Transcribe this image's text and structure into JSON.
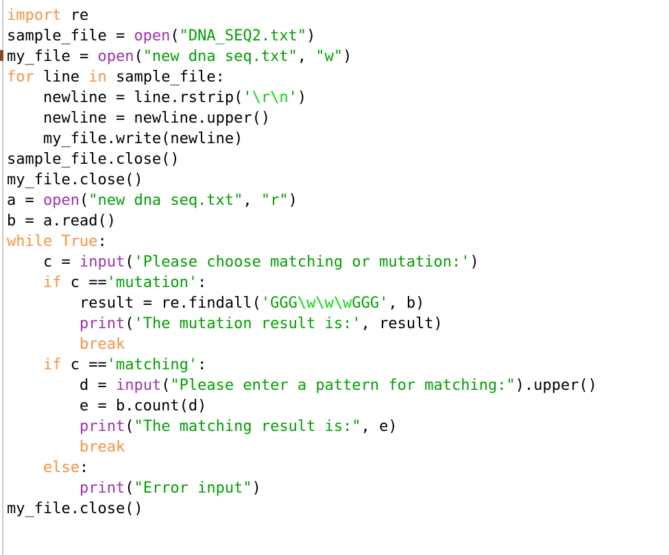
{
  "document": {
    "kind": "python-source-code",
    "language": "Python",
    "background_color": "#ffffff",
    "default_text_color": "#000000"
  },
  "theme": {
    "keyword_color": "#ff9040",
    "builtin_color": "#a030b0",
    "string_color": "#00a000",
    "escape_color": "#00e000",
    "identifier_color": "#000000",
    "gutter_rule_color": "#c9c9c9",
    "gutter_marker_color": "#8a4a20"
  },
  "code": {
    "lines": [
      [
        {
          "t": "import",
          "c": "kw"
        },
        {
          "t": " re",
          "c": "id"
        }
      ],
      [
        {
          "t": "sample_file = ",
          "c": "id"
        },
        {
          "t": "open",
          "c": "bi"
        },
        {
          "t": "(",
          "c": "id"
        },
        {
          "t": "\"DNA_SEQ2.txt\"",
          "c": "str"
        },
        {
          "t": ")",
          "c": "id"
        }
      ],
      [
        {
          "t": "my_file = ",
          "c": "id"
        },
        {
          "t": "open",
          "c": "bi"
        },
        {
          "t": "(",
          "c": "id"
        },
        {
          "t": "\"new dna seq.txt\"",
          "c": "str"
        },
        {
          "t": ", ",
          "c": "id"
        },
        {
          "t": "\"w\"",
          "c": "str"
        },
        {
          "t": ")",
          "c": "id"
        }
      ],
      [
        {
          "t": "for",
          "c": "kw"
        },
        {
          "t": " line ",
          "c": "id"
        },
        {
          "t": "in",
          "c": "kw"
        },
        {
          "t": " sample_file:",
          "c": "id"
        }
      ],
      [
        {
          "t": "    newline = line.rstrip(",
          "c": "id"
        },
        {
          "t": "'",
          "c": "str"
        },
        {
          "t": "\\r",
          "c": "esc"
        },
        {
          "t": "\\n",
          "c": "esc"
        },
        {
          "t": "'",
          "c": "str"
        },
        {
          "t": ")",
          "c": "id"
        }
      ],
      [
        {
          "t": "    newline = newline.upper()",
          "c": "id"
        }
      ],
      [
        {
          "t": "    my_file.write(newline)",
          "c": "id"
        }
      ],
      [
        {
          "t": "sample_file.close()",
          "c": "id"
        }
      ],
      [
        {
          "t": "my_file.close()",
          "c": "id"
        }
      ],
      [
        {
          "t": "a = ",
          "c": "id"
        },
        {
          "t": "open",
          "c": "bi"
        },
        {
          "t": "(",
          "c": "id"
        },
        {
          "t": "\"new dna seq.txt\"",
          "c": "str"
        },
        {
          "t": ", ",
          "c": "id"
        },
        {
          "t": "\"r\"",
          "c": "str"
        },
        {
          "t": ")",
          "c": "id"
        }
      ],
      [
        {
          "t": "b = a.read()",
          "c": "id"
        }
      ],
      [
        {
          "t": "while",
          "c": "kw"
        },
        {
          "t": " ",
          "c": "id"
        },
        {
          "t": "True",
          "c": "kw"
        },
        {
          "t": ":",
          "c": "id"
        }
      ],
      [
        {
          "t": "    c = ",
          "c": "id"
        },
        {
          "t": "input",
          "c": "bi"
        },
        {
          "t": "(",
          "c": "id"
        },
        {
          "t": "'Please choose matching or mutation:'",
          "c": "str"
        },
        {
          "t": ")",
          "c": "id"
        }
      ],
      [
        {
          "t": "    ",
          "c": "id"
        },
        {
          "t": "if",
          "c": "kw"
        },
        {
          "t": " c ==",
          "c": "id"
        },
        {
          "t": "'mutation'",
          "c": "str"
        },
        {
          "t": ":",
          "c": "id"
        }
      ],
      [
        {
          "t": "        result = re.findall(",
          "c": "id"
        },
        {
          "t": "'GGG",
          "c": "str"
        },
        {
          "t": "\\w",
          "c": "esc"
        },
        {
          "t": "\\w",
          "c": "esc"
        },
        {
          "t": "\\w",
          "c": "esc"
        },
        {
          "t": "GGG'",
          "c": "str"
        },
        {
          "t": ", b)",
          "c": "id"
        }
      ],
      [
        {
          "t": "        ",
          "c": "id"
        },
        {
          "t": "print",
          "c": "bi"
        },
        {
          "t": "(",
          "c": "id"
        },
        {
          "t": "'The mutation result is:'",
          "c": "str"
        },
        {
          "t": ", result)",
          "c": "id"
        }
      ],
      [
        {
          "t": "        ",
          "c": "id"
        },
        {
          "t": "break",
          "c": "kw"
        }
      ],
      [
        {
          "t": "    ",
          "c": "id"
        },
        {
          "t": "if",
          "c": "kw"
        },
        {
          "t": " c ==",
          "c": "id"
        },
        {
          "t": "'matching'",
          "c": "str"
        },
        {
          "t": ":",
          "c": "id"
        }
      ],
      [
        {
          "t": "        d = ",
          "c": "id"
        },
        {
          "t": "input",
          "c": "bi"
        },
        {
          "t": "(",
          "c": "id"
        },
        {
          "t": "\"Please enter a pattern for matching:\"",
          "c": "str"
        },
        {
          "t": ").upper()",
          "c": "id"
        }
      ],
      [
        {
          "t": "        e = b.count(d)",
          "c": "id"
        }
      ],
      [
        {
          "t": "        ",
          "c": "id"
        },
        {
          "t": "print",
          "c": "bi"
        },
        {
          "t": "(",
          "c": "id"
        },
        {
          "t": "\"The matching result is:\"",
          "c": "str"
        },
        {
          "t": ", e)",
          "c": "id"
        }
      ],
      [
        {
          "t": "        ",
          "c": "id"
        },
        {
          "t": "break",
          "c": "kw"
        }
      ],
      [
        {
          "t": "    ",
          "c": "id"
        },
        {
          "t": "else",
          "c": "kw"
        },
        {
          "t": ":",
          "c": "id"
        }
      ],
      [
        {
          "t": "        ",
          "c": "id"
        },
        {
          "t": "print",
          "c": "bi"
        },
        {
          "t": "(",
          "c": "id"
        },
        {
          "t": "\"Error input\"",
          "c": "str"
        },
        {
          "t": ")",
          "c": "id"
        }
      ],
      [
        {
          "t": "my_file.close()",
          "c": "id"
        }
      ]
    ],
    "plain_text": "import re\nsample_file = open(\"DNA_SEQ2.txt\")\nmy_file = open(\"new dna seq.txt\", \"w\")\nfor line in sample_file:\n    newline = line.rstrip('\\r\\n')\n    newline = newline.upper()\n    my_file.write(newline)\nsample_file.close()\nmy_file.close()\na = open(\"new dna seq.txt\", \"r\")\nb = a.read()\nwhile True:\n    c = input('Please choose matching or mutation:')\n    if c =='mutation':\n        result = re.findall('GGG\\w\\w\\wGGG', b)\n        print('The mutation result is:', result)\n        break\n    if c =='matching':\n        d = input(\"Please enter a pattern for matching:\").upper()\n        e = b.count(d)\n        print(\"The matching result is:\", e)\n        break\n    else:\n        print(\"Error input\")\nmy_file.close()"
  }
}
